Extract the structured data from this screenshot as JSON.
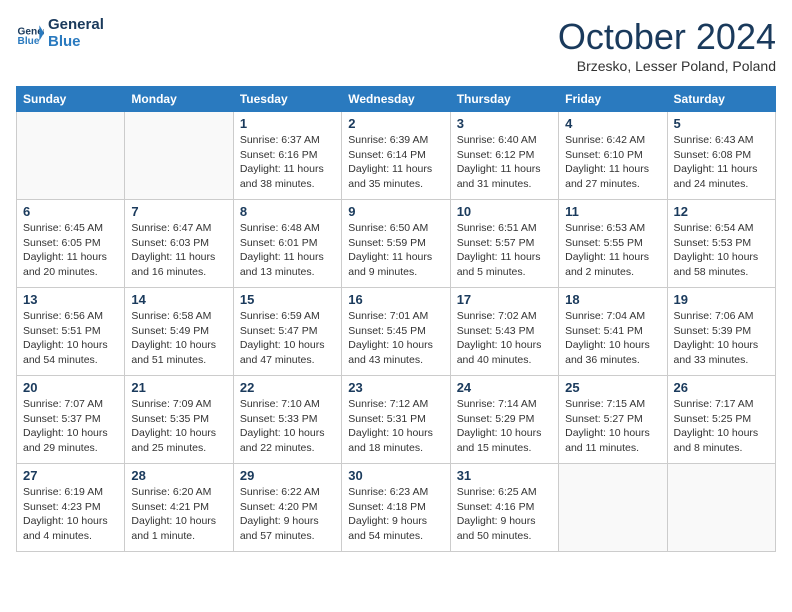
{
  "header": {
    "logo": {
      "line1": "General",
      "line2": "Blue"
    },
    "title": "October 2024",
    "subtitle": "Brzesko, Lesser Poland, Poland"
  },
  "days_of_week": [
    "Sunday",
    "Monday",
    "Tuesday",
    "Wednesday",
    "Thursday",
    "Friday",
    "Saturday"
  ],
  "weeks": [
    [
      {
        "day": "",
        "info": ""
      },
      {
        "day": "",
        "info": ""
      },
      {
        "day": "1",
        "info": "Sunrise: 6:37 AM\nSunset: 6:16 PM\nDaylight: 11 hours\nand 38 minutes."
      },
      {
        "day": "2",
        "info": "Sunrise: 6:39 AM\nSunset: 6:14 PM\nDaylight: 11 hours\nand 35 minutes."
      },
      {
        "day": "3",
        "info": "Sunrise: 6:40 AM\nSunset: 6:12 PM\nDaylight: 11 hours\nand 31 minutes."
      },
      {
        "day": "4",
        "info": "Sunrise: 6:42 AM\nSunset: 6:10 PM\nDaylight: 11 hours\nand 27 minutes."
      },
      {
        "day": "5",
        "info": "Sunrise: 6:43 AM\nSunset: 6:08 PM\nDaylight: 11 hours\nand 24 minutes."
      }
    ],
    [
      {
        "day": "6",
        "info": "Sunrise: 6:45 AM\nSunset: 6:05 PM\nDaylight: 11 hours\nand 20 minutes."
      },
      {
        "day": "7",
        "info": "Sunrise: 6:47 AM\nSunset: 6:03 PM\nDaylight: 11 hours\nand 16 minutes."
      },
      {
        "day": "8",
        "info": "Sunrise: 6:48 AM\nSunset: 6:01 PM\nDaylight: 11 hours\nand 13 minutes."
      },
      {
        "day": "9",
        "info": "Sunrise: 6:50 AM\nSunset: 5:59 PM\nDaylight: 11 hours\nand 9 minutes."
      },
      {
        "day": "10",
        "info": "Sunrise: 6:51 AM\nSunset: 5:57 PM\nDaylight: 11 hours\nand 5 minutes."
      },
      {
        "day": "11",
        "info": "Sunrise: 6:53 AM\nSunset: 5:55 PM\nDaylight: 11 hours\nand 2 minutes."
      },
      {
        "day": "12",
        "info": "Sunrise: 6:54 AM\nSunset: 5:53 PM\nDaylight: 10 hours\nand 58 minutes."
      }
    ],
    [
      {
        "day": "13",
        "info": "Sunrise: 6:56 AM\nSunset: 5:51 PM\nDaylight: 10 hours\nand 54 minutes."
      },
      {
        "day": "14",
        "info": "Sunrise: 6:58 AM\nSunset: 5:49 PM\nDaylight: 10 hours\nand 51 minutes."
      },
      {
        "day": "15",
        "info": "Sunrise: 6:59 AM\nSunset: 5:47 PM\nDaylight: 10 hours\nand 47 minutes."
      },
      {
        "day": "16",
        "info": "Sunrise: 7:01 AM\nSunset: 5:45 PM\nDaylight: 10 hours\nand 43 minutes."
      },
      {
        "day": "17",
        "info": "Sunrise: 7:02 AM\nSunset: 5:43 PM\nDaylight: 10 hours\nand 40 minutes."
      },
      {
        "day": "18",
        "info": "Sunrise: 7:04 AM\nSunset: 5:41 PM\nDaylight: 10 hours\nand 36 minutes."
      },
      {
        "day": "19",
        "info": "Sunrise: 7:06 AM\nSunset: 5:39 PM\nDaylight: 10 hours\nand 33 minutes."
      }
    ],
    [
      {
        "day": "20",
        "info": "Sunrise: 7:07 AM\nSunset: 5:37 PM\nDaylight: 10 hours\nand 29 minutes."
      },
      {
        "day": "21",
        "info": "Sunrise: 7:09 AM\nSunset: 5:35 PM\nDaylight: 10 hours\nand 25 minutes."
      },
      {
        "day": "22",
        "info": "Sunrise: 7:10 AM\nSunset: 5:33 PM\nDaylight: 10 hours\nand 22 minutes."
      },
      {
        "day": "23",
        "info": "Sunrise: 7:12 AM\nSunset: 5:31 PM\nDaylight: 10 hours\nand 18 minutes."
      },
      {
        "day": "24",
        "info": "Sunrise: 7:14 AM\nSunset: 5:29 PM\nDaylight: 10 hours\nand 15 minutes."
      },
      {
        "day": "25",
        "info": "Sunrise: 7:15 AM\nSunset: 5:27 PM\nDaylight: 10 hours\nand 11 minutes."
      },
      {
        "day": "26",
        "info": "Sunrise: 7:17 AM\nSunset: 5:25 PM\nDaylight: 10 hours\nand 8 minutes."
      }
    ],
    [
      {
        "day": "27",
        "info": "Sunrise: 6:19 AM\nSunset: 4:23 PM\nDaylight: 10 hours\nand 4 minutes."
      },
      {
        "day": "28",
        "info": "Sunrise: 6:20 AM\nSunset: 4:21 PM\nDaylight: 10 hours\nand 1 minute."
      },
      {
        "day": "29",
        "info": "Sunrise: 6:22 AM\nSunset: 4:20 PM\nDaylight: 9 hours\nand 57 minutes."
      },
      {
        "day": "30",
        "info": "Sunrise: 6:23 AM\nSunset: 4:18 PM\nDaylight: 9 hours\nand 54 minutes."
      },
      {
        "day": "31",
        "info": "Sunrise: 6:25 AM\nSunset: 4:16 PM\nDaylight: 9 hours\nand 50 minutes."
      },
      {
        "day": "",
        "info": ""
      },
      {
        "day": "",
        "info": ""
      }
    ]
  ]
}
